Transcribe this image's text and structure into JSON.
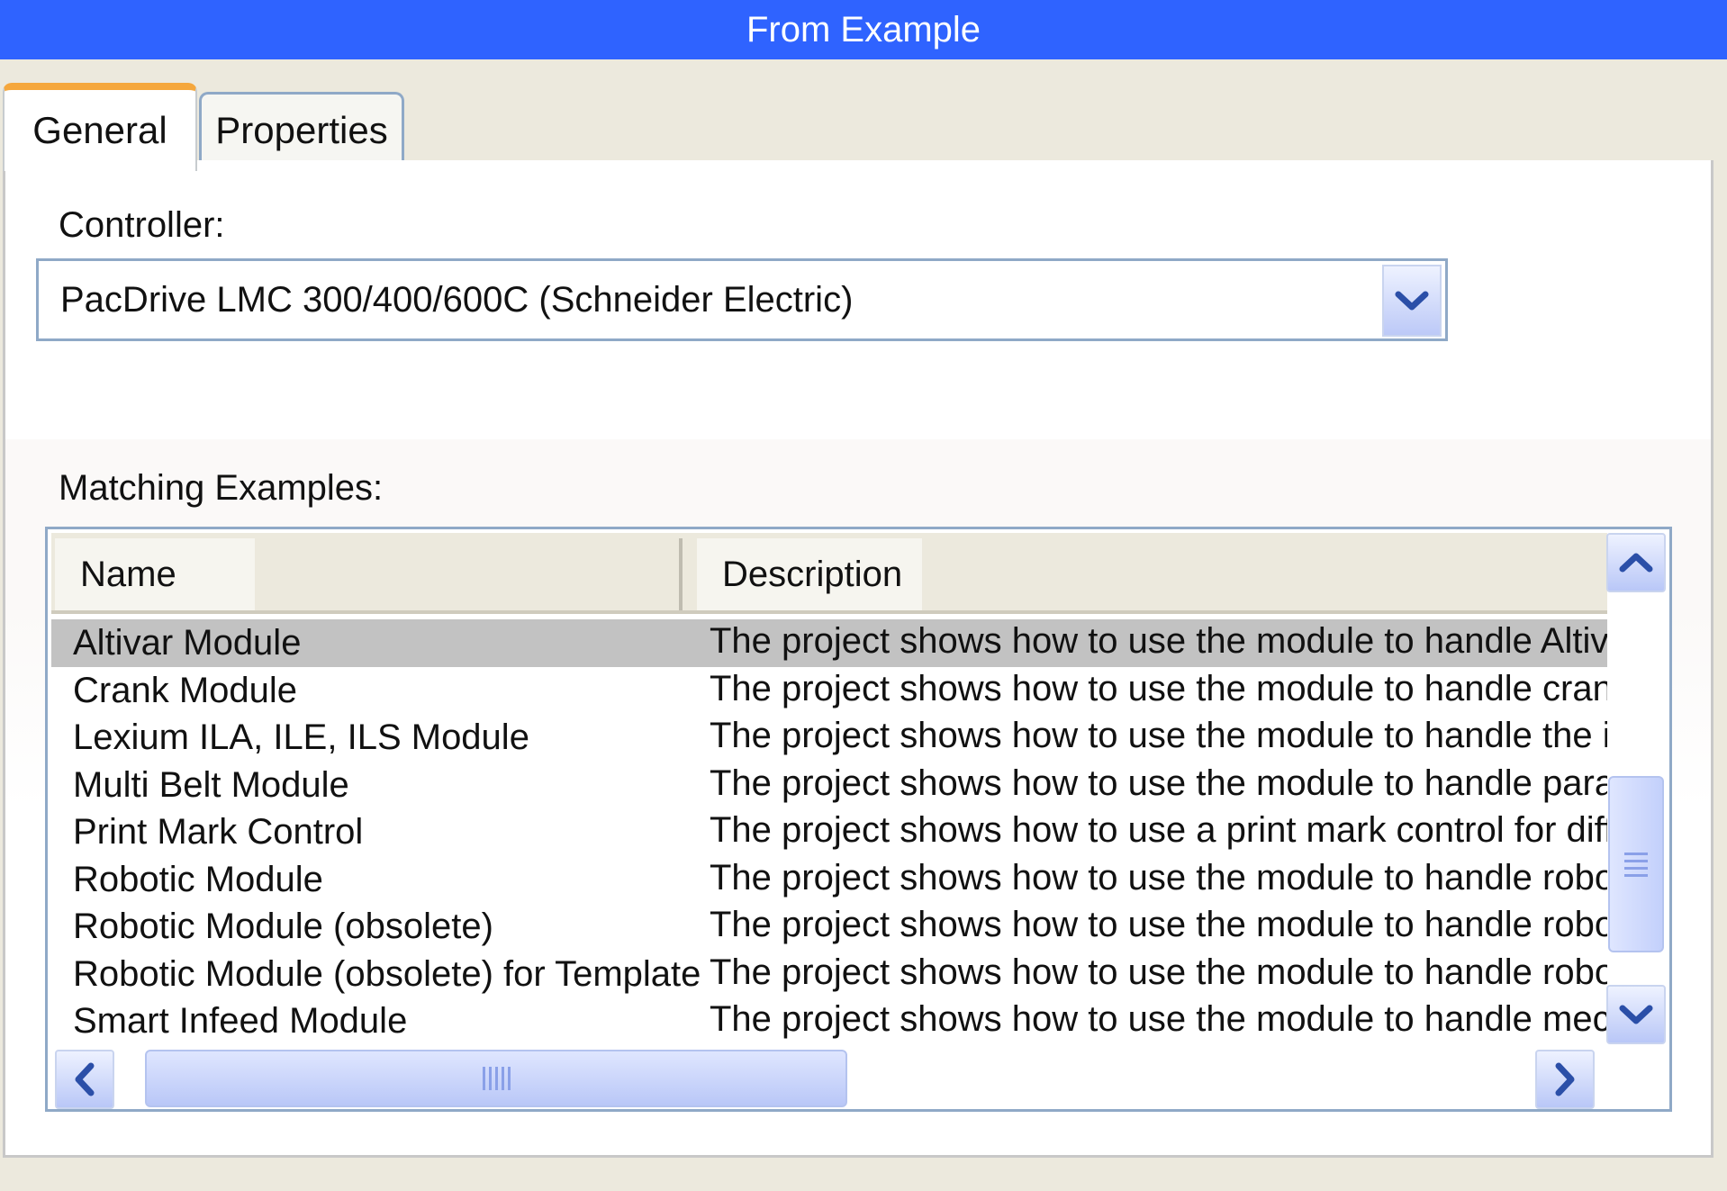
{
  "window": {
    "title": "From Example"
  },
  "tabs": [
    {
      "label": "General",
      "active": true
    },
    {
      "label": "Properties",
      "active": false
    }
  ],
  "controller": {
    "label": "Controller:",
    "value": "PacDrive LMC 300/400/600C (Schneider Electric)"
  },
  "examples": {
    "label": "Matching Examples:",
    "columns": [
      "Name",
      "Description"
    ],
    "rows": [
      {
        "name": "Altivar Module",
        "description": "The project shows how to use the module to handle Altivar freq",
        "selected": true
      },
      {
        "name": "Crank Module",
        "description": "The project shows how to use the module to handle crank mec"
      },
      {
        "name": "Lexium ILA, ILE, ILS Module",
        "description": "The project shows how to use the module to handle the integra"
      },
      {
        "name": "Multi Belt Module",
        "description": "The project shows how to use the module to handle parallel wo"
      },
      {
        "name": "Print Mark Control",
        "description": "The project shows how to use a print mark control for different"
      },
      {
        "name": "Robotic Module",
        "description": "The project shows how to use the module to handle robot kine"
      },
      {
        "name": "Robotic Module (obsolete)",
        "description": "The project shows how to use the module to handle robot kine"
      },
      {
        "name": "Robotic Module (obsolete) for Template",
        "description": "The project shows how to use the module to handle robot kine"
      },
      {
        "name": "Smart Infeed Module",
        "description": "The project shows how to use the module to handle mechanics"
      }
    ]
  },
  "colors": {
    "title_bar": "#2f63ff",
    "active_tab_accent": "#f5a73c",
    "border": "#8fa9c7",
    "selected_row": "#c2c2c2"
  }
}
